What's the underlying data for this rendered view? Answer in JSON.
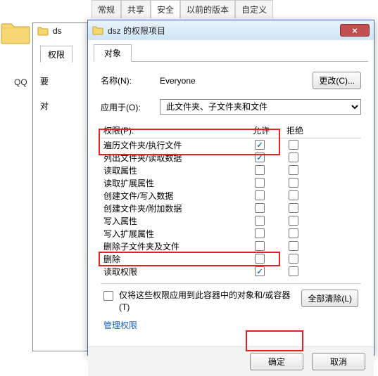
{
  "bg_tabs": [
    "常规",
    "共享",
    "安全",
    "以前的版本",
    "自定义"
  ],
  "bg_active_tab": 2,
  "qq_label": "QQ ",
  "win1": {
    "title_prefix": "ds",
    "tab": "权限",
    "row_label": "要"
  },
  "dialog": {
    "title": "dsz 的权限项目",
    "tab": "对象",
    "name_label": "名称(N):",
    "name_value": "Everyone",
    "change_btn": "更改(C)...",
    "apply_label": "应用于(O):",
    "apply_value": "此文件夹、子文件夹和文件",
    "perm_label": "权限(P):",
    "col_allow": "允许",
    "col_deny": "拒绝",
    "permissions": [
      {
        "label": "遍历文件夹/执行文件",
        "allow": true,
        "deny": false
      },
      {
        "label": "列出文件夹/读取数据",
        "allow": true,
        "deny": false
      },
      {
        "label": "读取属性",
        "allow": false,
        "deny": false
      },
      {
        "label": "读取扩展属性",
        "allow": false,
        "deny": false
      },
      {
        "label": "创建文件/写入数据",
        "allow": false,
        "deny": false
      },
      {
        "label": "创建文件夹/附加数据",
        "allow": false,
        "deny": false
      },
      {
        "label": "写入属性",
        "allow": false,
        "deny": false
      },
      {
        "label": "写入扩展属性",
        "allow": false,
        "deny": false
      },
      {
        "label": "删除子文件夹及文件",
        "allow": false,
        "deny": false
      },
      {
        "label": "删除",
        "allow": false,
        "deny": false
      },
      {
        "label": "读取权限",
        "allow": true,
        "deny": false
      }
    ],
    "apply_container": "仅将这些权限应用到此容器中的对象和/或容器(T)",
    "clear_all": "全部清除(L)",
    "manage_link": "管理权限",
    "ok": "确定",
    "cancel": "取消"
  }
}
